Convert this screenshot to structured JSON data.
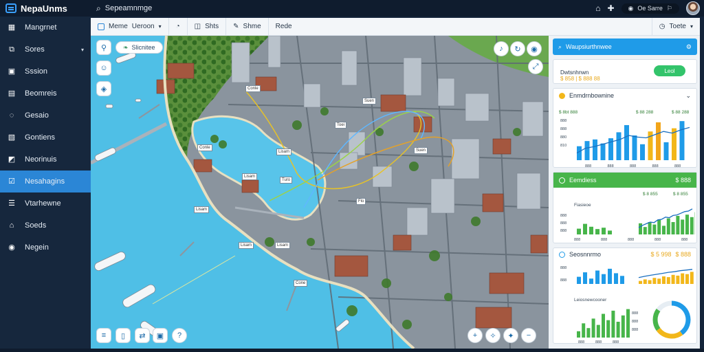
{
  "app": {
    "name": "NepaUnms"
  },
  "search": {
    "placeholder": "Sepeamnmge"
  },
  "topbar": {
    "user_label": "Oe Sarre"
  },
  "sidebar": {
    "items": [
      {
        "label": "Mangrnet",
        "icon": "grid-icon"
      },
      {
        "label": "Sores",
        "icon": "layers-icon",
        "has_caret": true
      },
      {
        "label": "Sssion",
        "icon": "monitor-icon"
      },
      {
        "label": "Beomreis",
        "icon": "folder-icon"
      },
      {
        "label": "Gesaio",
        "icon": "chat-icon"
      },
      {
        "label": "Gontiens",
        "icon": "document-icon"
      },
      {
        "label": "Neorinuis",
        "icon": "chart-icon"
      },
      {
        "label": "Nesahagins",
        "icon": "map-check-icon",
        "active": true
      },
      {
        "label": "Vtarhewne",
        "icon": "list-icon"
      },
      {
        "label": "Soeds",
        "icon": "building-icon"
      },
      {
        "label": "Negein",
        "icon": "settings-icon"
      }
    ]
  },
  "toolbar": {
    "map_label": "Meme",
    "layer_label": "Ueroon",
    "filter_label": "Shts",
    "ship_label": "Shme",
    "extra_label": "Rede",
    "right_label": "Toete"
  },
  "map": {
    "chip_label": "Slicnitee",
    "tags": [
      "Conle",
      "Conle",
      "Lisam",
      "Lisam",
      "Toei",
      "Suen",
      "Suen",
      "Turo",
      "Flo",
      "Lisam",
      "Lisam",
      "Lisam",
      "Cone"
    ]
  },
  "panel": {
    "search_card": {
      "title": "Waupsiurthnwee"
    },
    "summary_card": {
      "title": "Dwtsnhnwn",
      "amounts": "$ 858 | $ 888 88",
      "button_label": "Leol"
    },
    "chart_card_1": {
      "title": "Enmdrnbownine",
      "legend_left": "$ 8bt 888",
      "legend_right": "$ 88 288",
      "legend_far": "$ 88 288",
      "y_ticks": [
        "888",
        "888",
        "880",
        "810"
      ],
      "x_ticks": [
        "888",
        "888",
        "888",
        "888",
        "888"
      ]
    },
    "chart_card_2": {
      "title": "Eemdiess",
      "badge": "$ 888",
      "sub_title": "Fiasieoe",
      "legend_right": "$ 8 855",
      "legend_far": "$ 8 855",
      "y_ticks": [
        "888",
        "888",
        "888"
      ],
      "x_ticks": [
        "888",
        "888",
        "888",
        "888",
        "888"
      ]
    },
    "chart_card_3": {
      "title": "Seosnnrmo",
      "legend_right": "$ 5 998",
      "legend_far": "$ 888",
      "sub_title": "Leiosnewcooner",
      "y_ticks": [
        "888",
        "888",
        "888",
        "888",
        "888"
      ],
      "x_ticks": [
        "888",
        "888",
        "888",
        "888",
        "888"
      ]
    }
  },
  "colors": {
    "accent": "#2b86d6",
    "panel_blue": "#1f9be8",
    "panel_green": "#47b54a",
    "water": "#4fbfe6",
    "gold": "#f2b71a"
  },
  "chart_data": [
    {
      "type": "bar",
      "title": "Enmdrnbownine",
      "values": [
        35,
        48,
        52,
        42,
        55,
        70,
        88,
        62,
        40,
        72,
        95,
        45,
        80,
        98
      ],
      "colors": [
        "#1f9be8",
        "#1f9be8",
        "#1f9be8",
        "#1f9be8",
        "#1f9be8",
        "#1f9be8",
        "#1f9be8",
        "#1f9be8",
        "#1f9be8",
        "#f2b71a",
        "#f2a51a",
        "#1f9be8",
        "#f2b71a",
        "#1f9be8"
      ],
      "line": [
        18,
        30,
        34,
        40,
        46,
        52,
        62,
        58,
        56,
        64,
        72,
        68,
        76,
        82
      ],
      "ylim": [
        0,
        100
      ]
    },
    {
      "type": "bar",
      "title": "Fiasieoe",
      "values": [
        30,
        55,
        40,
        28,
        35,
        20,
        45,
        30,
        50,
        40,
        60,
        35,
        65,
        50,
        75,
        60,
        80,
        70,
        90
      ],
      "line": [
        20,
        28,
        34,
        40,
        38,
        48,
        50,
        58,
        56,
        64,
        66,
        72,
        78,
        80,
        88
      ],
      "ylim": [
        0,
        100
      ]
    },
    {
      "type": "bar",
      "title": "Seosnnrmo",
      "values": [
        40,
        65,
        30,
        75,
        55,
        85,
        60,
        45
      ],
      "right_values": [
        20,
        30,
        25,
        40,
        35,
        50,
        45,
        60,
        55,
        70,
        65,
        80
      ],
      "line": [
        30,
        38,
        44,
        50,
        56,
        62,
        66,
        72,
        76,
        80
      ],
      "ylim": [
        0,
        100
      ]
    },
    {
      "type": "bar",
      "title": "Leiosnewcooner",
      "values": [
        20,
        45,
        30,
        60,
        40,
        75,
        55,
        85,
        50,
        70,
        90
      ],
      "ylim": [
        0,
        100
      ]
    },
    {
      "type": "pie",
      "values": [
        40,
        25,
        20,
        15
      ],
      "colors": [
        "#1f9be8",
        "#f2b71a",
        "#47b54a",
        "#e6edf3"
      ]
    }
  ]
}
